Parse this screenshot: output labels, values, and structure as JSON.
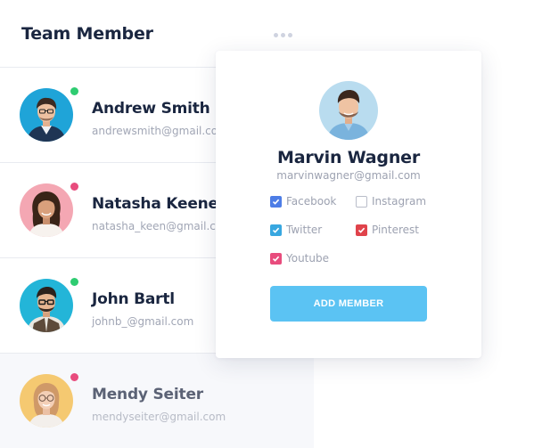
{
  "header": {
    "title": "Team Member",
    "more_icon": "more-horizontal-icon"
  },
  "members": [
    {
      "name": "Andrew Smith",
      "email": "andrewsmith@gmail.com",
      "status_color": "#2ecc71",
      "avatar_bg": "#1fa4d8",
      "faded": false
    },
    {
      "name": "Natasha Keener",
      "email": "natasha_keen@gmail.com",
      "status_color": "#e84c7d",
      "avatar_bg": "#f4a7b3",
      "faded": false
    },
    {
      "name": "John Bartl",
      "email": "johnb_@gmail.com",
      "status_color": "#2ecc71",
      "avatar_bg": "#23b5d8",
      "faded": false
    },
    {
      "name": "Mendy Seiter",
      "email": "mendyseiter@gmail.com",
      "status_color": "#e84c7d",
      "avatar_bg": "#f5c15a",
      "faded": true
    }
  ],
  "popup": {
    "name": "Marvin Wagner",
    "email": "marvinwagner@gmail.com",
    "avatar_bg": "#b9dcef",
    "options": [
      {
        "label": "Facebook",
        "checked": true,
        "color": "#4d7de6"
      },
      {
        "label": "Instagram",
        "checked": false,
        "color": "#b9bdc9"
      },
      {
        "label": "Twitter",
        "checked": true,
        "color": "#38a7e0"
      },
      {
        "label": "Pinterest",
        "checked": true,
        "color": "#e0434b"
      },
      {
        "label": "Youtube",
        "checked": true,
        "color": "#e84c7d"
      }
    ],
    "button_label": "ADD MEMBER",
    "button_color": "#5bc3f3"
  }
}
